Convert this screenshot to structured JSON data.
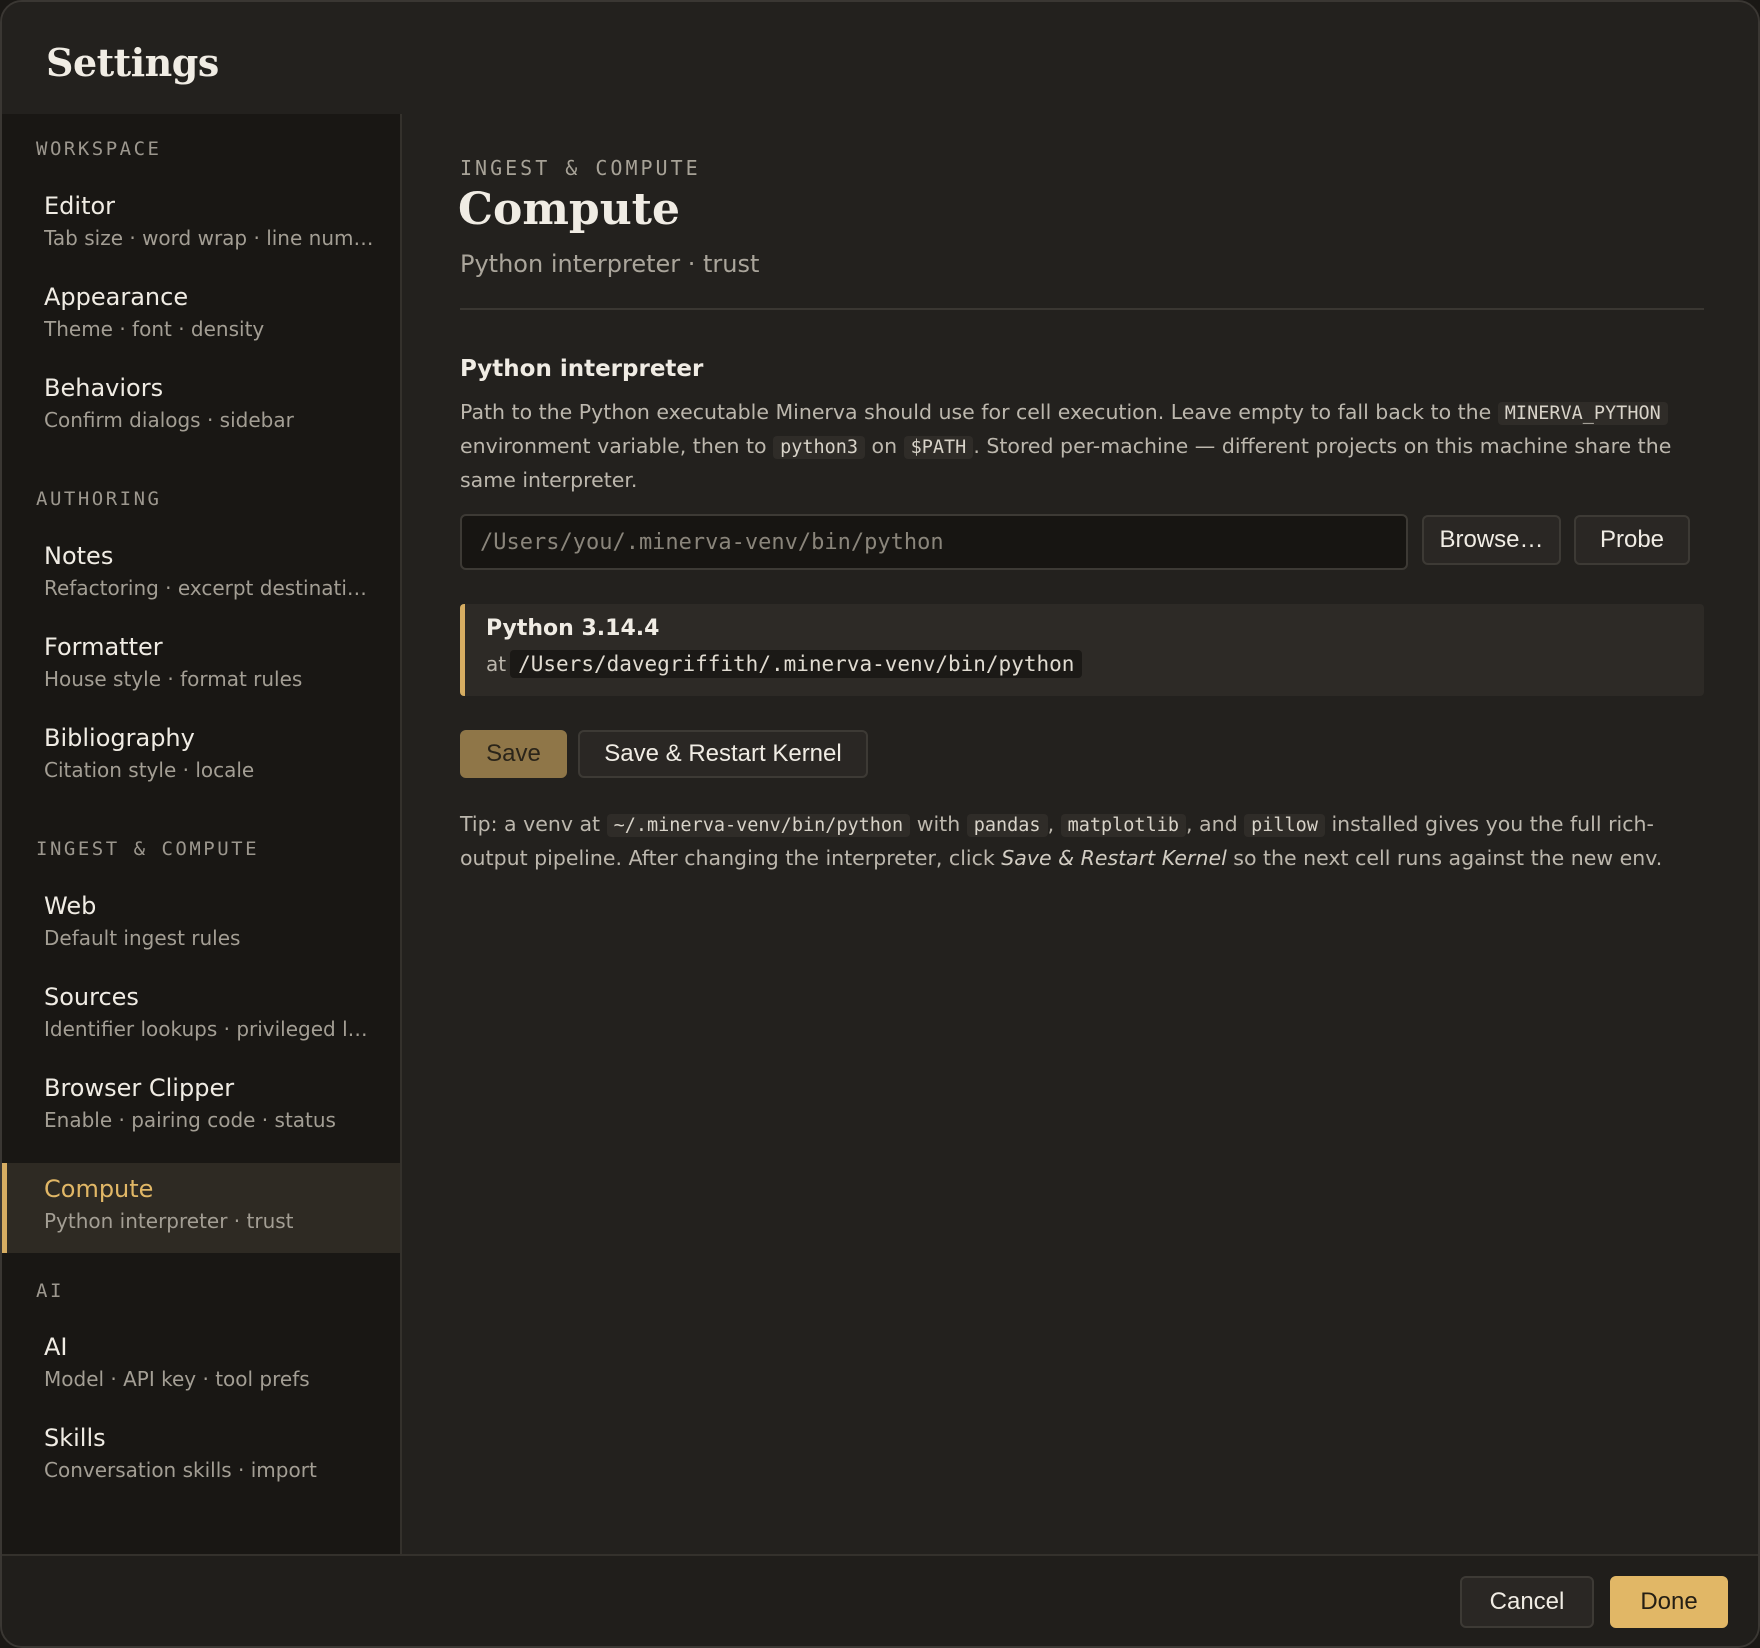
{
  "window": {
    "title": "Settings"
  },
  "sidebar": {
    "groups": [
      {
        "heading": "WORKSPACE"
      },
      {
        "heading": "AUTHORING"
      },
      {
        "heading": "INGEST & COMPUTE"
      },
      {
        "heading": "AI"
      }
    ],
    "items": [
      {
        "title": "Editor",
        "subtitle": "Tab size · word wrap · line numb…"
      },
      {
        "title": "Appearance",
        "subtitle": "Theme · font · density"
      },
      {
        "title": "Behaviors",
        "subtitle": "Confirm dialogs · sidebar"
      },
      {
        "title": "Notes",
        "subtitle": "Refactoring · excerpt destinations"
      },
      {
        "title": "Formatter",
        "subtitle": "House style · format rules"
      },
      {
        "title": "Bibliography",
        "subtitle": "Citation style · locale"
      },
      {
        "title": "Web",
        "subtitle": "Default ingest rules"
      },
      {
        "title": "Sources",
        "subtitle": "Identifier lookups · privileged lo…"
      },
      {
        "title": "Browser Clipper",
        "subtitle": "Enable · pairing code · status"
      },
      {
        "title": "Compute",
        "subtitle": "Python interpreter · trust",
        "active": true
      },
      {
        "title": "AI",
        "subtitle": "Model · API key · tool prefs"
      },
      {
        "title": "Skills",
        "subtitle": "Conversation skills · import"
      }
    ],
    "accent_color": "#d6ad62"
  },
  "main": {
    "eyebrow": "INGEST & COMPUTE",
    "title": "Compute",
    "subtitle": "Python interpreter · trust",
    "interpreter": {
      "heading": "Python interpreter",
      "desc_1": "Path to the Python executable Minerva should use for cell execution. Leave empty to fall back to the ",
      "desc_code_1": "MINERVA_PYTHON",
      "desc_2": " environment variable, then to ",
      "desc_code_2": "python3",
      "desc_3": " on ",
      "desc_code_3": "$PATH",
      "desc_4": ". Stored per-machine — different projects on this machine share the same interpreter.",
      "input_value": "",
      "input_placeholder": "/Users/you/.minerva-venv/bin/python",
      "browse_label": "Browse…",
      "probe_label": "Probe"
    },
    "probe_result": {
      "version": "Python 3.14.4",
      "at_label": "at",
      "path": "/Users/davegriffith/.minerva-venv/bin/python"
    },
    "actions": {
      "save_label": "Save",
      "save_restart_label": "Save & Restart Kernel"
    },
    "tip": {
      "t1": "Tip: a venv at ",
      "c1": "~/.minerva-venv/bin/python",
      "t2": " with ",
      "c2": "pandas",
      "t3": ", ",
      "c3": "matplotlib",
      "t4": ", and ",
      "c4": "pillow",
      "t5": " installed gives you the full rich-output pipeline. After changing the interpreter, click ",
      "em": "Save & Restart Kernel",
      "t6": " so the next cell runs against the new env."
    }
  },
  "footer": {
    "cancel_label": "Cancel",
    "done_label": "Done"
  }
}
